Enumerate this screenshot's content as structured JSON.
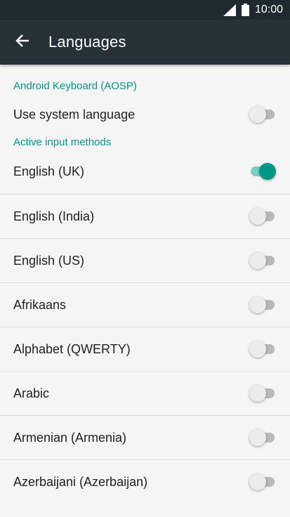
{
  "status_bar": {
    "time": "10:00",
    "signal_icon": "signal-icon",
    "battery_icon": "battery-icon"
  },
  "app_bar": {
    "back_icon": "arrow-back-icon",
    "title": "Languages"
  },
  "sections": [
    {
      "header": "Android Keyboard (AOSP)",
      "items": [
        {
          "label": "Use system language",
          "enabled": false
        }
      ]
    },
    {
      "header": "Active input methods",
      "items": [
        {
          "label": "English (UK)",
          "enabled": true
        },
        {
          "label": "English (India)",
          "enabled": false
        },
        {
          "label": "English (US)",
          "enabled": false
        },
        {
          "label": "Afrikaans",
          "enabled": false
        },
        {
          "label": "Alphabet (QWERTY)",
          "enabled": false
        },
        {
          "label": "Arabic",
          "enabled": false
        },
        {
          "label": "Armenian (Armenia)",
          "enabled": false
        },
        {
          "label": "Azerbaijani (Azerbaijan)",
          "enabled": false
        }
      ]
    }
  ],
  "colors": {
    "status_bar": "#1f2a30",
    "app_bar": "#263238",
    "accent": "#009688",
    "background": "#f5f5f5"
  }
}
